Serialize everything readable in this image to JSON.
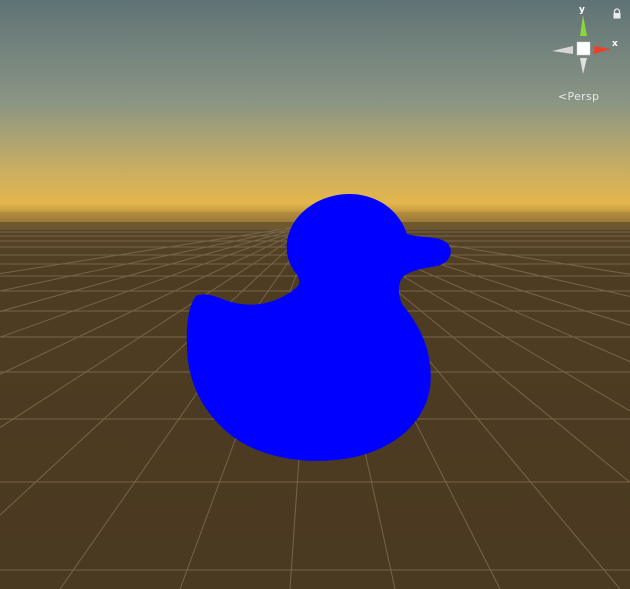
{
  "viewport": {
    "projection_label": "Persp",
    "gizmo": {
      "axis_y_label": "y",
      "axis_x_label": "x",
      "colors": {
        "y": "#8cd63a",
        "x": "#e8432a",
        "neutral": "#d8d8d8",
        "center": "#ffffff"
      }
    },
    "icons": {
      "lock": "lock-icon",
      "projection": "perspective-icon"
    }
  },
  "scene": {
    "object": "duck",
    "object_color": "#0000ff",
    "ground_color": "#4a3a22",
    "sky_top_color": "#5f7376",
    "horizon_color": "#e6b84f"
  }
}
